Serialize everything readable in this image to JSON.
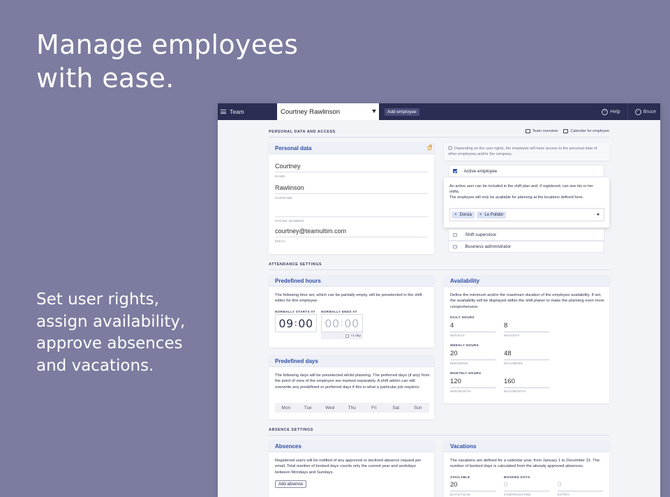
{
  "hero": {
    "title": "Manage employees with ease.",
    "subtitle": "Set user rights, assign availability, approve absences and vacations."
  },
  "topbar": {
    "team_label": "Team",
    "employee_select": "Courtney Rawlinson",
    "add_employee": "Add employee",
    "help": "Help",
    "user": "Bruce"
  },
  "sections": {
    "personal": "PERSONAL DATA AND ACCESS",
    "attendance": "ATTENDANCE SETTINGS",
    "absence": "ABSENCE SETTINGS"
  },
  "links": {
    "team_overview": "Team overview",
    "calendar": "Calendar for employee"
  },
  "personal": {
    "header": "Personal data",
    "first_name": "Courtney",
    "first_name_caption": "NAME",
    "surname": "Rawlinson",
    "surname_caption": "SURNAME",
    "phone": "",
    "phone_caption": "PHONE NUMBER",
    "email": "courtney@teamultim.com",
    "email_caption": "EMAIL"
  },
  "access": {
    "info": "Depending on the user rights, the employee will have access to the personal data of other employees and/or the company.",
    "active_label": "Active employee",
    "active_checked": true,
    "active_desc": "An active user can be included in the shift plan and, if registered, can see his or her shifts.",
    "locations_desc": "The employee will only be available for planning at the locations defined here.",
    "locations": [
      "Dorsia",
      "Le Polidor"
    ],
    "shift_supervisor": "Shift supervisor",
    "business_admin": "Business administrator"
  },
  "predefined_hours": {
    "header": "Predefined hours",
    "desc": "The following time set, which can be partially empty, will be preselected in the shift editor for this employee.",
    "start_caption": "NORMALLY STARTS AT",
    "end_caption": "NORMALLY ENDS AT",
    "start_h": "09",
    "start_m": "00",
    "end_h": "00",
    "end_m": "00",
    "plus_day": "+1 day"
  },
  "predefined_days": {
    "header": "Predefined days",
    "desc": "The following days will be preselected whilst planning. The preferred days (if any) from the point of view of the employee are marked separately. A shift admin can still overwrite any predefined or preferred days if this is what a particular job requires.",
    "days": [
      "Mon",
      "Tue",
      "Wed",
      "Thu",
      "Fri",
      "Sat",
      "Sun"
    ]
  },
  "availability": {
    "header": "Availability",
    "desc": "Define the minimum and/or the maximum duration of the employee availability. If set, the availability will be displayed within the shift planer to make the planning even more comprehensive.",
    "daily_caption": "DAILY HOURS",
    "daily_min": "4",
    "daily_min_caption": "MIN/DAY",
    "daily_max": "8",
    "daily_max_caption": "MAX/DAY",
    "weekly_caption": "WEEKLY HOURS",
    "weekly_min": "20",
    "weekly_min_caption": "MIN/WEEK",
    "weekly_max": "48",
    "weekly_max_caption": "MAX/WEEK",
    "monthly_caption": "MONTHLY HOURS",
    "monthly_min": "120",
    "monthly_min_caption": "MIN/MONTH",
    "monthly_max": "160",
    "monthly_max_caption": "MAX/MONTH"
  },
  "absences": {
    "header": "Absences",
    "desc": "Registered users will be notified of any approved or declined absence request per email. Total number of booked days counts only the current year and workdays between Mondays and Sundays.",
    "add_button": "Add absence"
  },
  "vacations": {
    "header": "Vacations",
    "desc": "The vacations are defined for a calendar year, from January 1 to December 31. The number of booked days is calculated from the already approved absences.",
    "available_caption": "AVAILABLE",
    "available": "20",
    "available_sub": "DAYS/YEAR",
    "booked_caption": "BOOKED DAYS",
    "booked": "0",
    "booked_sub": "COMPENSATED",
    "extra": "0",
    "extra_sub": "EXTRA"
  }
}
